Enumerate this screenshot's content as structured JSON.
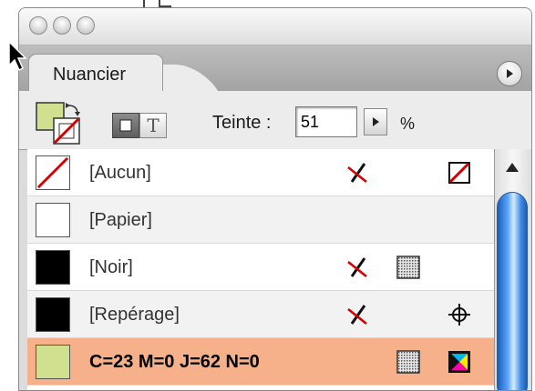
{
  "palette": {
    "tab_label": "Nuancier"
  },
  "toolbar": {
    "tint_label": "Teinte :",
    "tint_value": "51",
    "tint_unit": "%",
    "text_mode_glyph": "T"
  },
  "swatches": [
    {
      "name": "[Aucun]",
      "color": "#ffffff",
      "swatch_icon": "none-slash-icon",
      "non_editable_icon": "pencil-crossed-icon",
      "type_icon": "none-type-icon"
    },
    {
      "name": "[Papier]",
      "color": "#ffffff"
    },
    {
      "name": "[Noir]",
      "color": "#000000",
      "non_editable_icon": "pencil-crossed-icon",
      "type_icon": "process-color-icon"
    },
    {
      "name": "[Repérage]",
      "color": "#000000",
      "non_editable_icon": "pencil-crossed-icon",
      "type_icon": "registration-target-icon"
    },
    {
      "name": "C=23 M=0 J=62 N=0",
      "color": "#d1e08e",
      "type_icon": "process-color-icon",
      "mode_icon": "cmyk-mode-icon",
      "selected": true
    }
  ],
  "colors": {
    "selection_highlight": "#f6b18a",
    "fill_preview": "#d1e08e",
    "stroke_none_red": "#d40000",
    "scroll_thumb_blue": "#3d89e6"
  }
}
